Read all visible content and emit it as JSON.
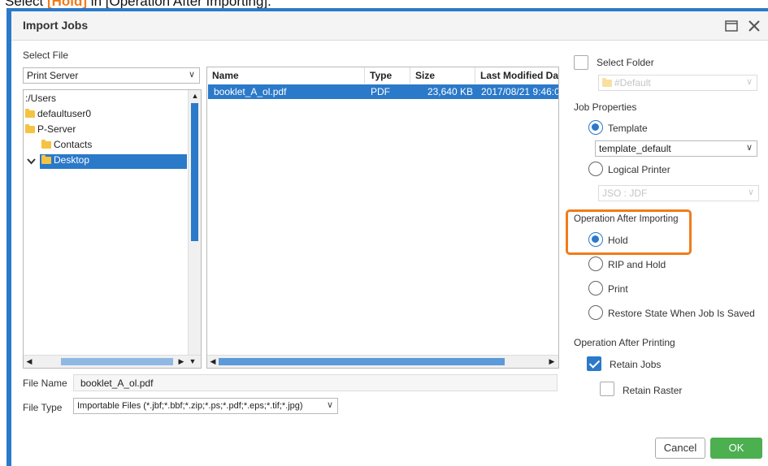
{
  "instruction": {
    "prefix": "Select ",
    "highlight": "[Hold]",
    "suffix": " in [Operation After Importing]."
  },
  "dialog": {
    "title": "Import Jobs"
  },
  "left": {
    "select_file_label": "Select File",
    "source_select": "Print Server",
    "tree": [
      {
        "label": ":/Users",
        "icon": "none",
        "expander": ""
      },
      {
        "label": "defaultuser0",
        "icon": "folder",
        "expander": ""
      },
      {
        "label": "P-Server",
        "icon": "folder",
        "expander": ""
      },
      {
        "label": "Contacts",
        "icon": "folder",
        "expander": ""
      },
      {
        "label": "Desktop",
        "icon": "folder",
        "expander": "chevron-down",
        "selected": true
      }
    ]
  },
  "files": {
    "columns": [
      "Name",
      "Type",
      "Size",
      "Last Modified Da"
    ],
    "rows": [
      {
        "name": "booklet_A_ol.pdf",
        "type": "PDF",
        "size": "23,640 KB",
        "modified": "2017/08/21 9:46:0"
      }
    ]
  },
  "bottom": {
    "file_name_label": "File Name",
    "file_name_value": "booklet_A_ol.pdf",
    "file_type_label": "File Type",
    "file_type_value": "Importable Files (*.jbf;*.bbf;*.zip;*.ps;*.pdf;*.eps;*.tif;*.jpg)"
  },
  "right": {
    "select_folder_label": "Select Folder",
    "folder_select": "#Default",
    "job_properties_label": "Job Properties",
    "template_label": "Template",
    "template_select": "template_default",
    "logical_printer_label": "Logical Printer",
    "logical_printer_select": "JSO : JDF",
    "op_after_import_label": "Operation After Importing",
    "import_options": [
      "Hold",
      "RIP and Hold",
      "Print",
      "Restore State When Job Is Saved"
    ],
    "import_selected": "Hold",
    "op_after_print_label": "Operation After Printing",
    "retain_jobs_label": "Retain Jobs",
    "retain_jobs_checked": true,
    "retain_raster_label": "Retain Raster",
    "retain_raster_checked": false
  },
  "buttons": {
    "cancel": "Cancel",
    "ok": "OK"
  },
  "colors": {
    "accent": "#2b79c9",
    "highlight": "#f07c1c",
    "ok": "#4caf50"
  }
}
